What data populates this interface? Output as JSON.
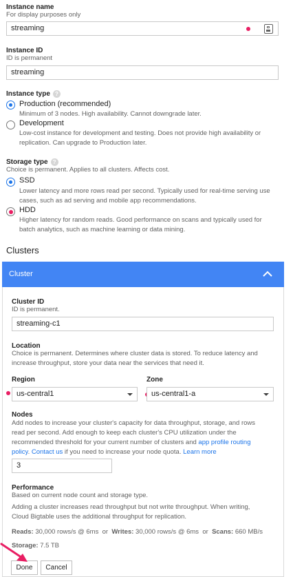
{
  "instance_name": {
    "label": "Instance name",
    "hint": "For display purposes only",
    "value": "streaming"
  },
  "instance_id": {
    "label": "Instance ID",
    "hint": "ID is permanent",
    "value": "streaming"
  },
  "instance_type": {
    "label": "Instance type",
    "options": [
      {
        "label": "Production (recommended)",
        "desc": "Minimum of 3 nodes. High availability. Cannot downgrade later.",
        "selected": true
      },
      {
        "label": "Development",
        "desc_line1": "Low-cost instance for development and testing. Does not provide high availability or",
        "desc_line2": "replication. Can upgrade to Production later.",
        "selected": false
      }
    ]
  },
  "storage_type": {
    "label": "Storage type",
    "hint": "Choice is permanent. Applies to all clusters. Affects cost.",
    "options": [
      {
        "label": "SSD",
        "desc_line1": "Lower latency and more rows read per second. Typically used for real-time serving use",
        "desc_line2": "cases, such as ad serving and mobile app recommendations.",
        "selected": true
      },
      {
        "label": "HDD",
        "desc_line1": "Higher latency for random reads. Good performance on scans and typically used for",
        "desc_line2": "batch analytics, such as machine learning or data mining.",
        "selected": false
      }
    ]
  },
  "clusters": {
    "heading": "Clusters",
    "panel_title": "Cluster",
    "cluster_id": {
      "label": "Cluster ID",
      "hint": "ID is permanent.",
      "value": "streaming-c1"
    },
    "location": {
      "label": "Location",
      "hint_line1": "Choice is permanent. Determines where cluster data is stored. To reduce latency and",
      "hint_line2": "increase throughput, store your data near the services that need it."
    },
    "region": {
      "label": "Region",
      "value": "us-central1"
    },
    "zone": {
      "label": "Zone",
      "value": "us-central1-a"
    },
    "nodes": {
      "label": "Nodes",
      "hint_line1": "Add nodes to increase your cluster's capacity for data throughput, storage, and rows",
      "hint_line2": "read per second. Add enough to keep each cluster's CPU utilization under the",
      "hint_line3_pre": "recommended threshold for your current number of clusters and ",
      "link_app_profile": "app profile routing",
      "link_policy": "policy",
      "sep": ". ",
      "link_contact": "Contact us",
      "hint_line4_mid": " if you need to increase your node quota. ",
      "link_learn": "Learn more",
      "value": "3"
    },
    "performance": {
      "label": "Performance",
      "hint": "Based on current node count and storage type.",
      "desc_line1": "Adding a cluster increases read throughput but not write throughput. When writing,",
      "desc_line2": "Cloud Bigtable uses the additional throughput for replication.",
      "reads_label": "Reads:",
      "reads_value": "30,000 rows/s @ 6ms",
      "or1": "or",
      "writes_label": "Writes:",
      "writes_value": "30,000 rows/s @ 6ms",
      "or2": "or",
      "scans_label": "Scans:",
      "scans_value": "660 MB/s",
      "storage_label": "Storage:",
      "storage_value": "7.5 TB"
    },
    "buttons": {
      "done": "Done",
      "cancel": "Cancel"
    }
  },
  "colors": {
    "accent": "#4285f4",
    "radio": "#1a73e8",
    "marker": "#e91e63",
    "link": "#1a73e8"
  },
  "icons": [
    "card-icon",
    "help-icon",
    "chevron-up-icon",
    "dropdown-caret-icon",
    "arrow-pointer-icon"
  ]
}
